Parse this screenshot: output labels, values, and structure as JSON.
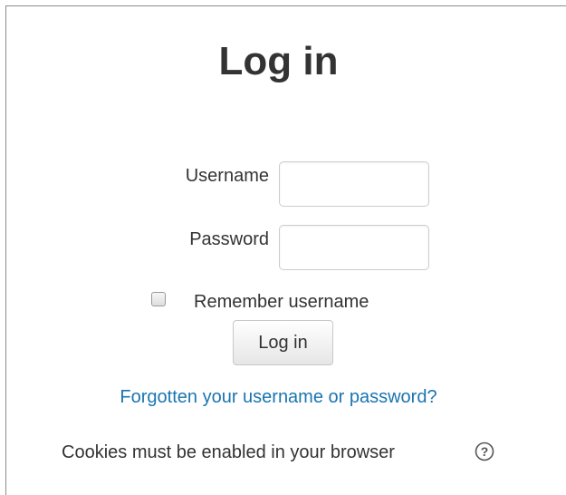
{
  "page": {
    "title": "Log in"
  },
  "form": {
    "username_label": "Username",
    "username_value": "",
    "password_label": "Password",
    "password_value": "",
    "remember_label": "Remember username",
    "remember_checked": false,
    "submit_label": "Log in"
  },
  "links": {
    "forgot": "Forgotten your username or password?"
  },
  "notice": {
    "cookies": "Cookies must be enabled in your browser",
    "help_icon": "question-circle-icon"
  },
  "colors": {
    "link": "#1a75b0",
    "text": "#333333",
    "border": "#cccccc"
  }
}
